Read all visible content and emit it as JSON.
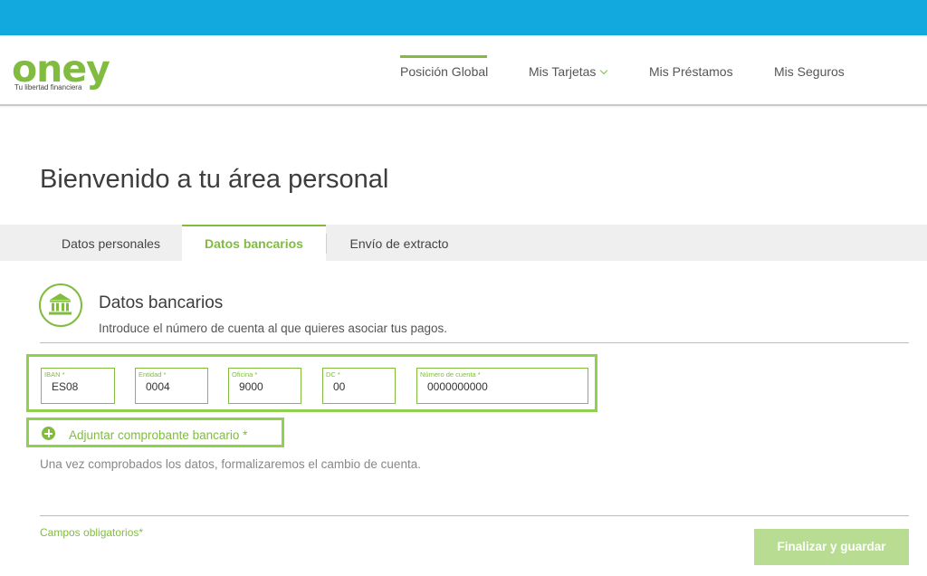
{
  "brand": {
    "name": "oney",
    "tagline": "Tu libertad financiera",
    "accent_color": "#81bc41",
    "topbar_color": "#12a9de"
  },
  "nav": {
    "items": [
      {
        "label": "Posición Global",
        "active": true
      },
      {
        "label": "Mis Tarjetas",
        "has_dropdown": true
      },
      {
        "label": "Mis Préstamos"
      },
      {
        "label": "Mis Seguros"
      }
    ]
  },
  "page": {
    "title": "Bienvenido a tu área personal"
  },
  "tabs": [
    {
      "label": "Datos personales"
    },
    {
      "label": "Datos bancarios",
      "active": true
    },
    {
      "label": "Envío de extracto"
    }
  ],
  "section": {
    "icon": "bank-icon",
    "title": "Datos bancarios",
    "subtitle": "Introduce el número de cuenta al que quieres asociar tus pagos."
  },
  "fields": {
    "iban": {
      "label": "IBAN *",
      "value": "ES08"
    },
    "entidad": {
      "label": "Entidad *",
      "value": "0004"
    },
    "oficina": {
      "label": "Oficina *",
      "value": "9000"
    },
    "dc": {
      "label": "DC *",
      "value": "00"
    },
    "cuenta": {
      "label": "Número de cuenta *",
      "value": "0000000000"
    }
  },
  "attach": {
    "icon": "plus-circle-icon",
    "label": "Adjuntar comprobante bancario *"
  },
  "note": "Una vez comprobados los datos, formalizaremos el cambio de cuenta.",
  "footer": {
    "required_note": "Campos obligatorios*",
    "save_label": "Finalizar y guardar"
  }
}
